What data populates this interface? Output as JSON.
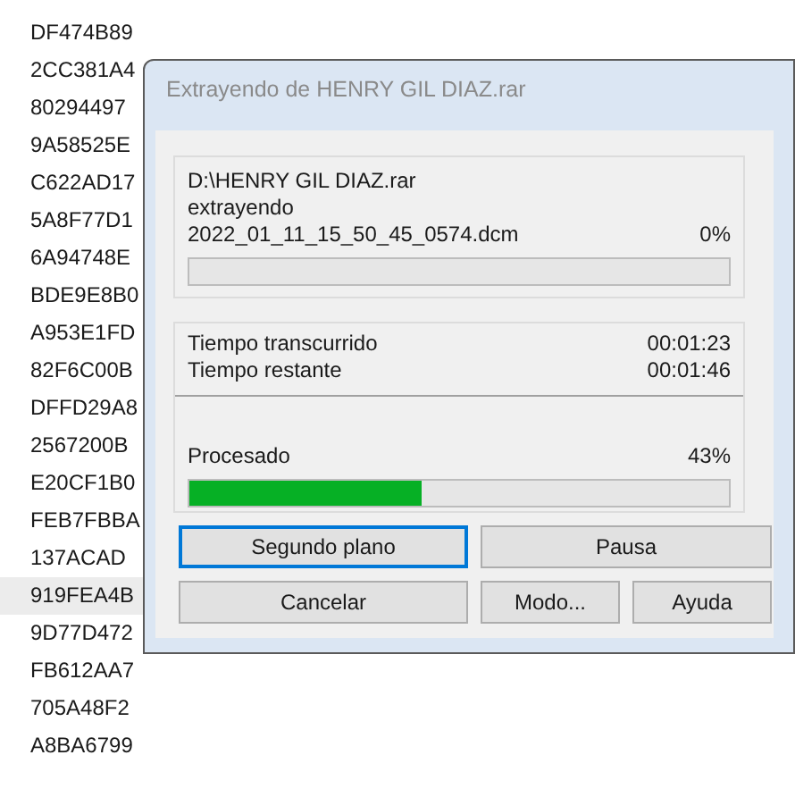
{
  "list": [
    {
      "text": "DF474B89",
      "selected": false
    },
    {
      "text": "2CC381A4",
      "selected": false
    },
    {
      "text": "80294497",
      "selected": false
    },
    {
      "text": "9A58525E",
      "selected": false
    },
    {
      "text": "C622AD17",
      "selected": false
    },
    {
      "text": "5A8F77D1",
      "selected": false
    },
    {
      "text": "6A94748E",
      "selected": false
    },
    {
      "text": "BDE9E8B0",
      "selected": false
    },
    {
      "text": "A953E1FD",
      "selected": false
    },
    {
      "text": "82F6C00B",
      "selected": false
    },
    {
      "text": "DFFD29A8",
      "selected": false
    },
    {
      "text": "2567200B",
      "selected": false
    },
    {
      "text": "E20CF1B0",
      "selected": false
    },
    {
      "text": "FEB7FBBA",
      "selected": false
    },
    {
      "text": "137ACAD",
      "selected": false
    },
    {
      "text": "919FEA4B",
      "selected": true
    },
    {
      "text": "9D77D472",
      "selected": false
    },
    {
      "text": "FB612AA7",
      "selected": false
    },
    {
      "text": "705A48F2",
      "selected": false
    },
    {
      "text": "A8BA6799",
      "selected": false
    }
  ],
  "dialog": {
    "title": "Extrayendo de HENRY GIL DIAZ.rar",
    "archive": "D:\\HENRY GIL DIAZ.rar",
    "action": "extrayendo",
    "file": "2022_01_11_15_50_45_0574.dcm",
    "file_percent": "0%",
    "times": [
      {
        "label": "Tiempo transcurrido",
        "value": "00:01:23"
      },
      {
        "label": "Tiempo restante",
        "value": "00:01:46"
      }
    ],
    "processed": {
      "label": "Procesado",
      "percent": "43%",
      "level": 0.43
    },
    "button_rows": [
      [
        {
          "label": "Segundo plano",
          "focused": true
        },
        {
          "label": "Pausa",
          "focused": false
        }
      ],
      [
        {
          "label": "Cancelar",
          "focused": false
        },
        {
          "label": "Modo...",
          "focused": false
        },
        {
          "label": "Ayuda",
          "focused": false
        }
      ]
    ]
  }
}
